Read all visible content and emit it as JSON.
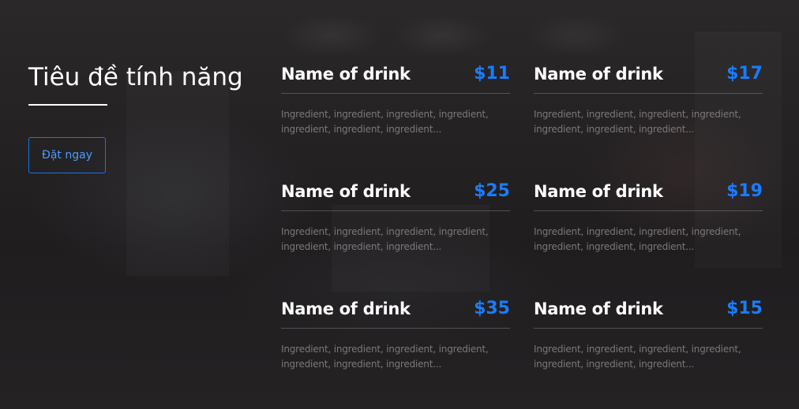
{
  "hero": {
    "title": "Tiêu đề tính năng",
    "cta_label": "Đặt ngay"
  },
  "menu": {
    "items": [
      {
        "name": "Name of drink",
        "price": "$11",
        "description": "Ingredient, ingredient, ingredient, ingredient, ingredient, ingredient, ingredient..."
      },
      {
        "name": "Name of drink",
        "price": "$17",
        "description": "Ingredient, ingredient, ingredient, ingredient, ingredient, ingredient, ingredient..."
      },
      {
        "name": "Name of drink",
        "price": "$25",
        "description": "Ingredient, ingredient, ingredient, ingredient, ingredient, ingredient, ingredient..."
      },
      {
        "name": "Name of drink",
        "price": "$19",
        "description": "Ingredient, ingredient, ingredient, ingredient, ingredient, ingredient, ingredient..."
      },
      {
        "name": "Name of drink",
        "price": "$35",
        "description": "Ingredient, ingredient, ingredient, ingredient, ingredient, ingredient, ingredient..."
      },
      {
        "name": "Name of drink",
        "price": "$15",
        "description": "Ingredient, ingredient, ingredient, ingredient, ingredient, ingredient, ingredient..."
      }
    ]
  },
  "colors": {
    "accent": "#1a7cff",
    "background": "#201e1f",
    "text": "#ffffff",
    "muted_text": "#7b7878"
  }
}
